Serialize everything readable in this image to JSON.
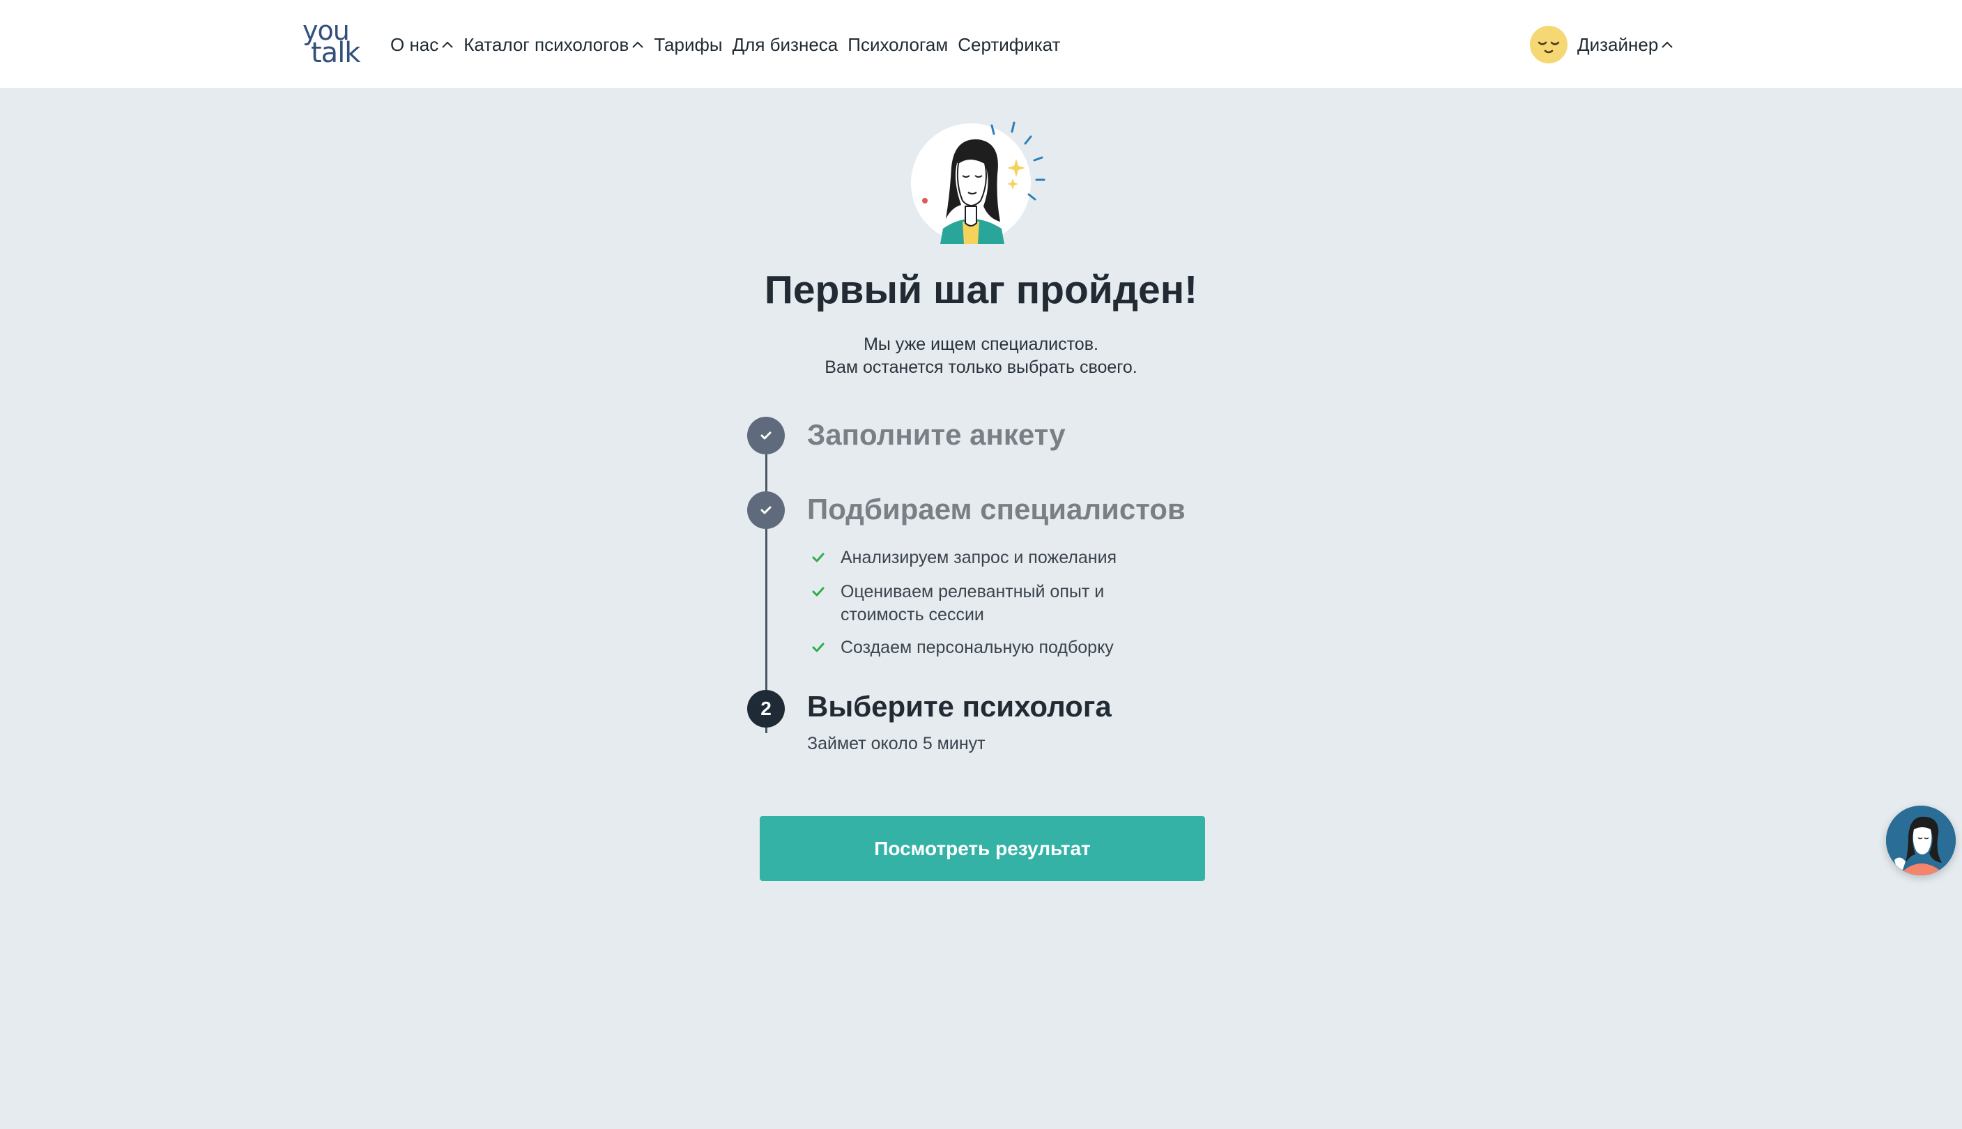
{
  "header": {
    "logo": {
      "line1": "you",
      "line2": "talk"
    },
    "nav": [
      {
        "label": "О нас",
        "has_dropdown": true
      },
      {
        "label": "Каталог психологов",
        "has_dropdown": true
      },
      {
        "label": "Тарифы",
        "has_dropdown": false
      },
      {
        "label": "Для бизнеса",
        "has_dropdown": false
      },
      {
        "label": "Психологам",
        "has_dropdown": false
      },
      {
        "label": "Сертификат",
        "has_dropdown": false
      }
    ],
    "user": {
      "name": "Дизайнер",
      "avatar_icon": "sleepy-face-icon",
      "avatar_color": "#f5d774"
    }
  },
  "main": {
    "hero_icon": "woman-illustration",
    "title": "Первый шаг пройден!",
    "subtitle_lines": [
      "Мы уже ищем специалистов.",
      "Вам останется только выбрать своего."
    ],
    "steps": [
      {
        "status": "done",
        "title": "Заполните анкету"
      },
      {
        "status": "done",
        "title": "Подбираем специалистов",
        "items": [
          "Анализируем запрос и пожелания",
          "Оцениваем релевантный опыт и стоимость сессии",
          "Создаем персональную подборку"
        ]
      },
      {
        "status": "active",
        "number": "2",
        "title": "Выберите психолога",
        "note": "Займет около 5 минут"
      }
    ],
    "cta_label": "Посмотреть результат"
  },
  "chat_widget_icon": "support-avatar-icon",
  "colors": {
    "background": "#e6ebf0",
    "accent": "#34b2a6",
    "done_step": "#5f6b7c",
    "active_step": "#1e2a36",
    "check_green": "#2cae4a",
    "logo": "#33507a"
  }
}
